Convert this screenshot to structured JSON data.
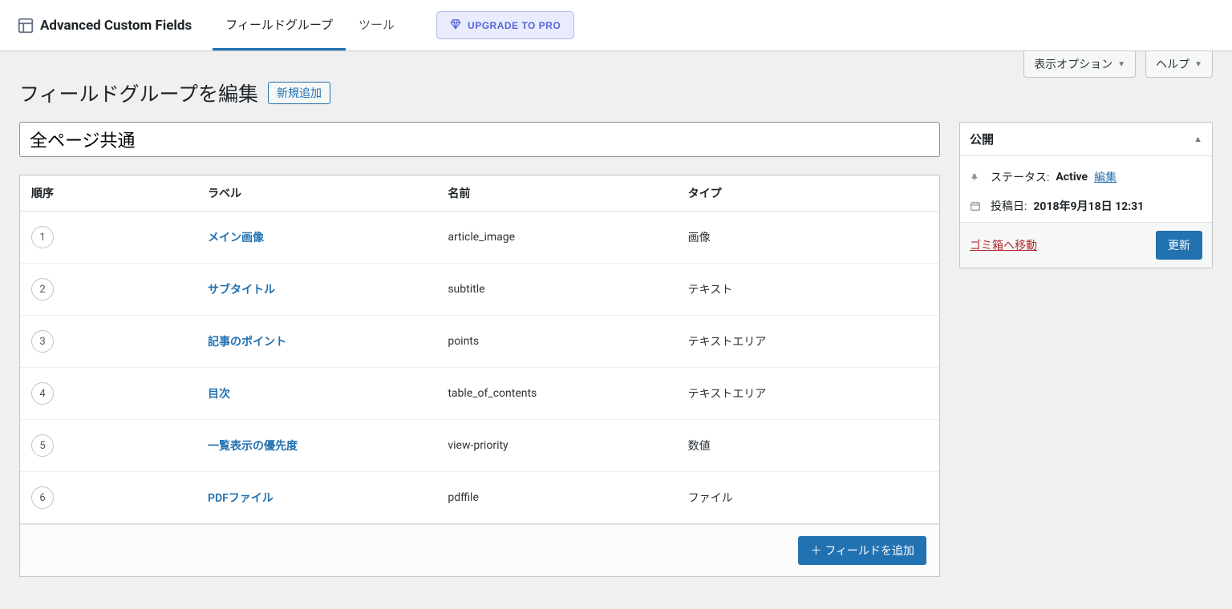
{
  "topbar": {
    "brand": "Advanced Custom Fields",
    "nav": [
      {
        "label": "フィールドグループ",
        "active": true
      },
      {
        "label": "ツール",
        "active": false
      }
    ],
    "upgrade_label": "UPGRADE TO PRO"
  },
  "screen_options": {
    "display_options": "表示オプション",
    "help": "ヘルプ"
  },
  "header": {
    "title": "フィールドグループを編集",
    "add_new": "新規追加"
  },
  "group": {
    "title": "全ページ共通"
  },
  "fields": {
    "columns": {
      "order": "順序",
      "label": "ラベル",
      "name": "名前",
      "type": "タイプ"
    },
    "rows": [
      {
        "order": "1",
        "label": "メイン画像",
        "name": "article_image",
        "type": "画像"
      },
      {
        "order": "2",
        "label": "サブタイトル",
        "name": "subtitle",
        "type": "テキスト"
      },
      {
        "order": "3",
        "label": "記事のポイント",
        "name": "points",
        "type": "テキストエリア"
      },
      {
        "order": "4",
        "label": "目次",
        "name": "table_of_contents",
        "type": "テキストエリア"
      },
      {
        "order": "5",
        "label": "一覧表示の優先度",
        "name": "view-priority",
        "type": "数値"
      },
      {
        "order": "6",
        "label": "PDFファイル",
        "name": "pdffile",
        "type": "ファイル"
      }
    ],
    "add_field": "＋ フィールドを追加"
  },
  "publish": {
    "heading": "公開",
    "status_label": "ステータス:",
    "status_value": "Active",
    "edit": "編集",
    "date_label": "投稿日:",
    "date_value": "2018年9月18日 12:31",
    "trash": "ゴミ箱へ移動",
    "update": "更新"
  }
}
